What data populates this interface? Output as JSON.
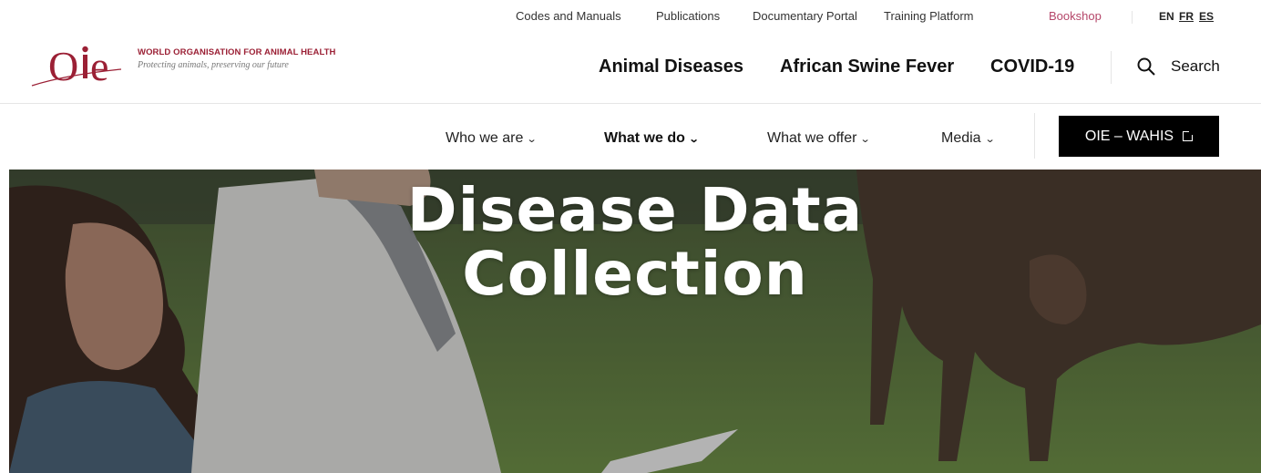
{
  "org": {
    "logo_text": "OIE",
    "name": "WORLD ORGANISATION FOR ANIMAL HEALTH",
    "tagline": "Protecting animals, preserving our future"
  },
  "top_links": [
    "Codes and Manuals",
    "Publications",
    "Documentary Portal",
    "Training Platform",
    "Bookshop"
  ],
  "languages": [
    "EN",
    "FR",
    "ES"
  ],
  "main_links": [
    "Animal Diseases",
    "African Swine Fever",
    "COVID-19"
  ],
  "search": {
    "label": "Search",
    "icon": "search-icon"
  },
  "nav": {
    "items": [
      "Who we are",
      "What we do",
      "What we offer",
      "Media"
    ],
    "active": "What we do",
    "wahis_label": "OIE – WAHIS",
    "wahis_icon": "external-link-icon"
  },
  "hero": {
    "title_line1": "Disease Data",
    "title_line2": "Collection"
  },
  "colors": {
    "brand": "#9b2035",
    "bookshop": "#b5476a",
    "button_bg": "#000000"
  }
}
